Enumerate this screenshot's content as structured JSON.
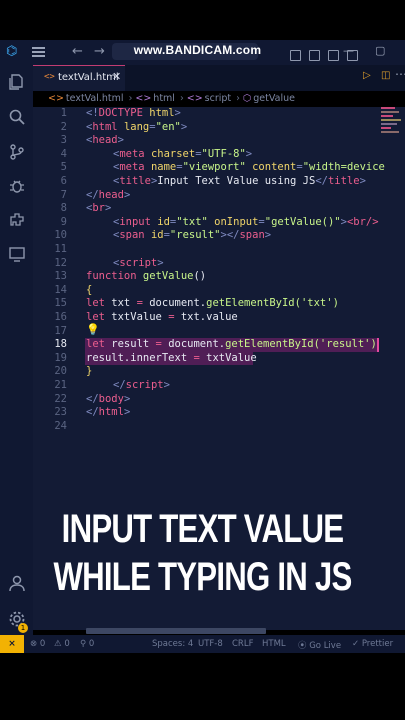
{
  "watermark": "www.BANDICAM.com",
  "tab": {
    "icon": "<>",
    "label": "textVal.html",
    "close": "✕"
  },
  "breadcrumb": [
    {
      "icon": "<>",
      "label": "textVal.html"
    },
    {
      "icon": "<>",
      "label": "html"
    },
    {
      "icon": "<>",
      "label": "script"
    },
    {
      "icon": "⬡",
      "label": "getValue"
    }
  ],
  "code": {
    "lines": [
      "1",
      "2",
      "3",
      "4",
      "5",
      "6",
      "7",
      "8",
      "9",
      "10",
      "11",
      "12",
      "13",
      "14",
      "15",
      "16",
      "17",
      "18",
      "19",
      "20",
      "21",
      "22",
      "23",
      "24"
    ],
    "active_line": "18",
    "html": {
      "l1a": "<!",
      "l1b": "DOCTYPE",
      "l1c": " html",
      "l1d": ">",
      "open": "<",
      "close": ">",
      "end_open": "</",
      "html": "html",
      "lang": " lang",
      "eq": "=",
      "en": "\"en\"",
      "head": "head",
      "meta": "meta",
      "charset": " charset",
      "utf8": "\"UTF-8\"",
      "name": " name",
      "viewport": "\"viewport\"",
      "content": " content",
      "width_dev": "\"width=device",
      "title": "title",
      "title_text": "Input Text Value using JS",
      "br": "br",
      "input": "input",
      "id": " id",
      "txt": "\"txt\"",
      "oninput": " onInput",
      "getvalue_call": "\"getValue()\"",
      "br_selfclose": "<br/>",
      "span": "span",
      "result": "\"result\"",
      "script": "script",
      "body": "body"
    },
    "js": {
      "function": "function",
      "fn_name": " getValue",
      "parens": "()",
      "brace_open": "{",
      "brace_close": "}",
      "let": "let",
      "txt": " txt ",
      "eq": "=",
      "doc": " document.",
      "getel": "getElementById",
      "arg_txt": "('txt')",
      "txtvalue": " txtValue ",
      "txt_value": " txt.value",
      "result": " result ",
      "arg_result": "('result')",
      "inner": "result.innerText ",
      "assign": "= ",
      "txtvalue_rhs": "txtValue"
    }
  },
  "caption": {
    "line1": "INPUT TEXT VALUE",
    "line2": "WHILE TYPING IN JS"
  },
  "status": {
    "remote": "⨯",
    "errors": "⊗ 0",
    "warnings": "⚠ 0",
    "ports": "⚲ 0",
    "spaces": "Spaces: 4",
    "encoding": "UTF-8",
    "eol": "CRLF",
    "language": "HTML",
    "golive": "⦿ Go Live",
    "prettier": "✓ Prettier",
    "bell": "🔔"
  },
  "badge": "1",
  "colors": {
    "background": "#131b35",
    "accent": "#ec5e8e",
    "string": "#c8f58a",
    "attr": "#f0d56a",
    "remote": "#f2b203"
  }
}
